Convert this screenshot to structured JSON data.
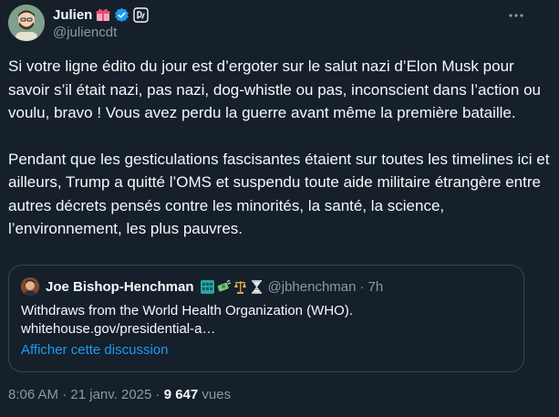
{
  "author": {
    "name": "Julien",
    "handle": "@juliencdt",
    "icons": [
      "gift-icon",
      "verified-icon",
      "org-badge-icon"
    ],
    "verified_color": "#1d9bf0"
  },
  "more_icon": "more-horizontal-icon",
  "tweet": {
    "paragraphs": [
      "Si votre ligne édito du jour est d’ergoter sur le salut nazi d’Elon Musk pour savoir s’il était nazi, pas nazi, dog-whistle ou pas, inconscient dans l’action ou voulu, bravo ! Vous avez perdu la guerre avant même la première bataille.",
      "Pendant que les gesticulations fascisantes étaient sur toutes les timelines ici et ailleurs, Trump a quitté l’OMS et suspendu toute aide militaire étrangère entre autres décrets pensés contre les minorités, la santé, la science, l’environnement, les plus pauvres."
    ]
  },
  "quote": {
    "name": "Joe Bishop-Henchman",
    "emojis": [
      "building-icon",
      "money-icon",
      "scales-icon",
      "hourglass-icon"
    ],
    "handle": "@jbhenchman",
    "separator": "·",
    "time": "7h",
    "text_line1": "Withdraws from the World Health Organization (WHO).",
    "text_line2": "whitehouse.gov/presidential-a…",
    "show_thread": "Afficher cette discussion"
  },
  "meta": {
    "time": "8:06 AM",
    "sep1": "·",
    "date": "21 janv. 2025",
    "sep2": "·",
    "views_count": "9 647",
    "views_label": "vues"
  },
  "colors": {
    "background": "#15202b",
    "text": "#f7f9f9",
    "secondary": "#8b98a5",
    "link": "#1d9bf0",
    "border": "#38444d"
  }
}
